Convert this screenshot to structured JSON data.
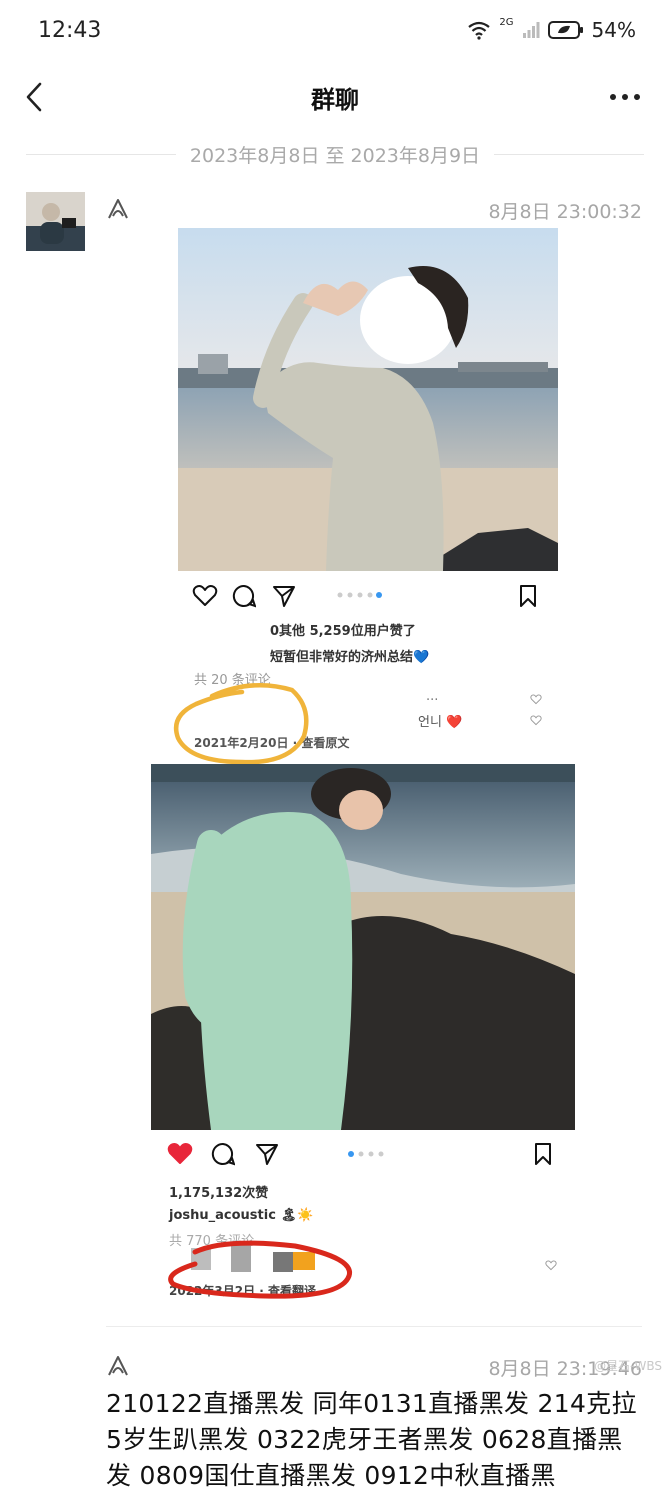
{
  "status_bar": {
    "time": "12:43",
    "network": "2G",
    "battery": "54%"
  },
  "nav": {
    "title": "群聊"
  },
  "date_range": "2023年8月8日 至 2023年8月9日",
  "messages": [
    {
      "time": "8月8日 23:00:32"
    },
    {
      "time": "8月8日 23:19:46"
    }
  ],
  "post1": {
    "likes": "0其他 5,259位用户赞了",
    "caption": "短暂但非常好的济州总结💙",
    "comments": "共 20 条评论",
    "comment_snippet": "...",
    "comment_snippet2": "언니 ❤️",
    "date": "2021年2月20日 · 查看原文"
  },
  "post2": {
    "likes": "1,175,132次赞",
    "username": "joshu_acoustic",
    "username_emoji": "🏝☀️",
    "comments": "共 770 条评论",
    "date": "2022年3月2日 · 查看翻译"
  },
  "message2_text": "210122直播黑发 同年0131直播黑发 214克拉5岁生趴黑发 0322虎牙王者黑发 0628直播黑发 0809国仕直播黑发 0912中秋直播黑",
  "watermark": "@星石-WBS",
  "colors": {
    "heart_red": "#e8263a",
    "circle_orange": "#f0b43a",
    "circle_red": "#d9281c"
  }
}
